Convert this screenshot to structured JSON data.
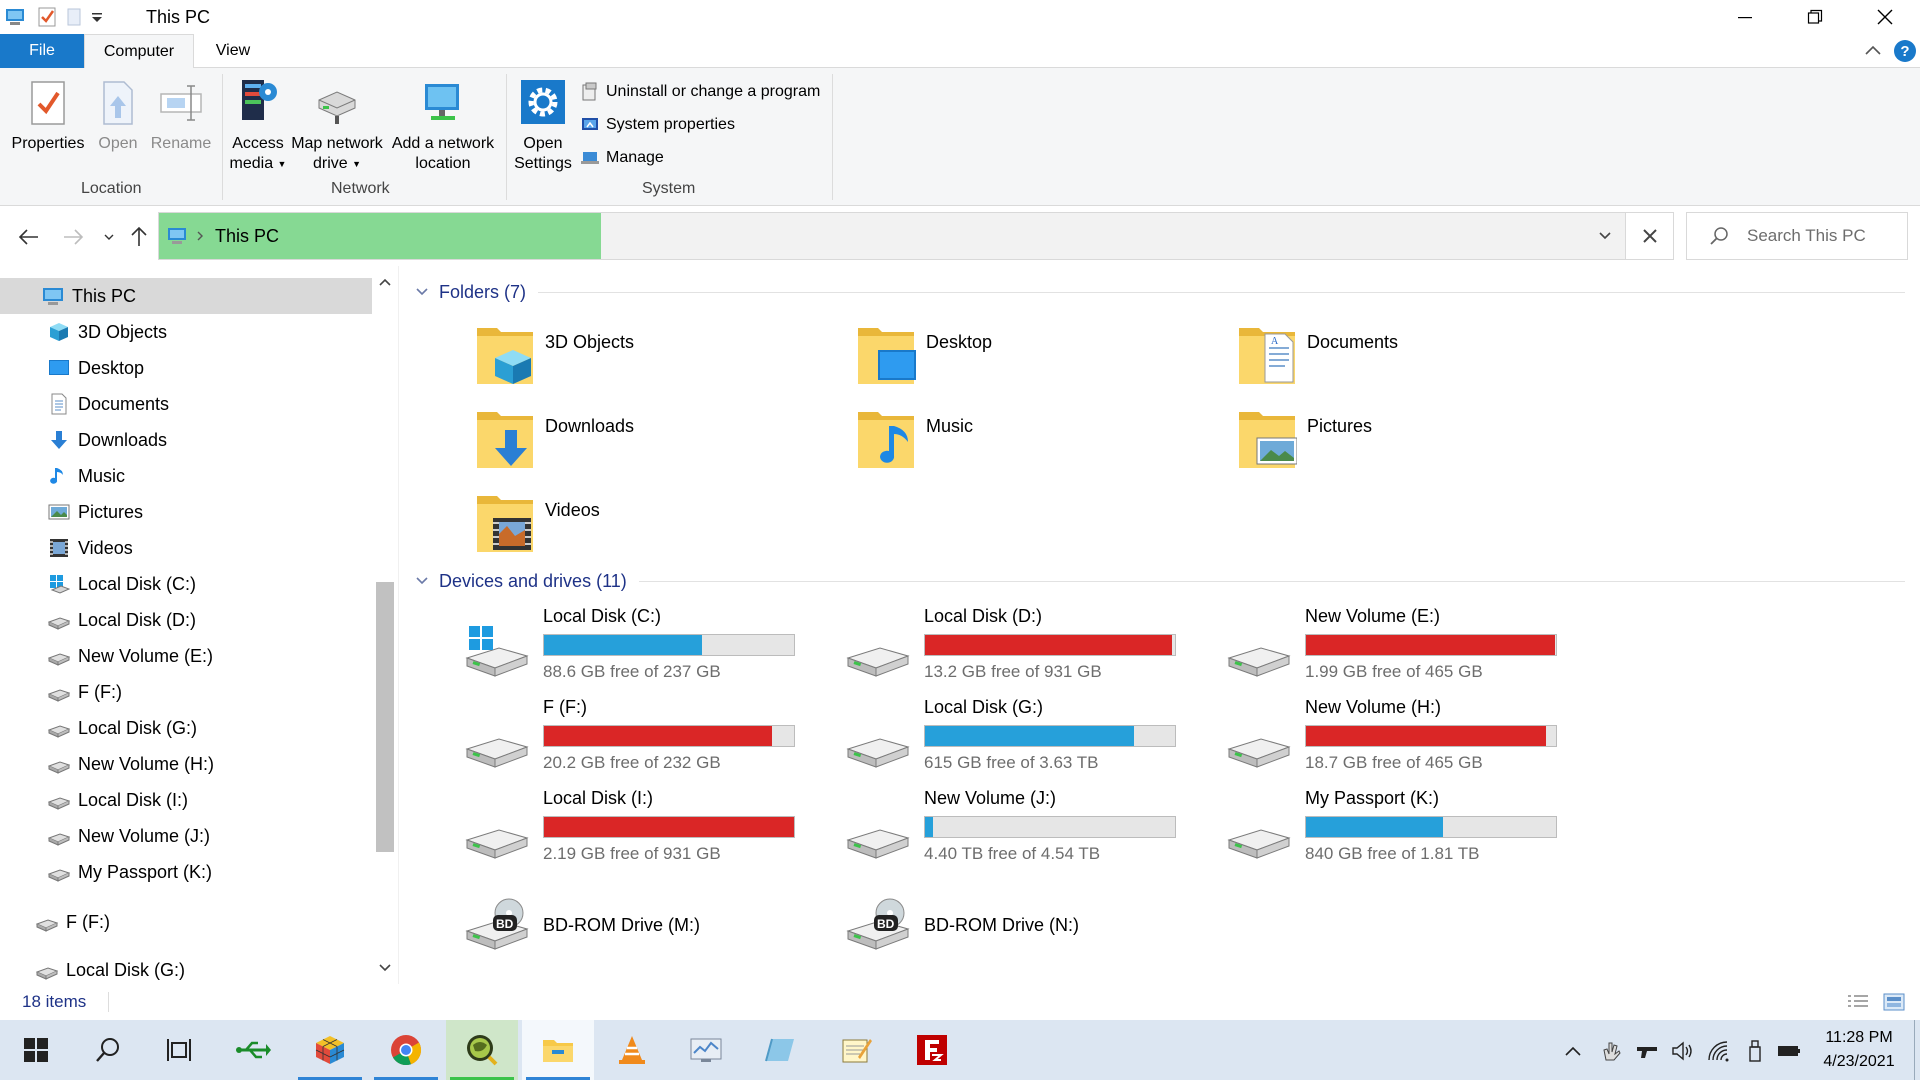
{
  "window": {
    "title": "This PC"
  },
  "tabs": {
    "file": "File",
    "computer": "Computer",
    "view": "View",
    "help": "?"
  },
  "ribbon": {
    "location": {
      "label": "Location",
      "properties": "Properties",
      "open": "Open",
      "rename": "Rename"
    },
    "network": {
      "label": "Network",
      "access_media_1": "Access",
      "access_media_2": "media",
      "map_drive_1": "Map network",
      "map_drive_2": "drive",
      "add_location_1": "Add a network",
      "add_location_2": "location"
    },
    "system": {
      "label": "System",
      "open_settings_1": "Open",
      "open_settings_2": "Settings",
      "uninstall": "Uninstall or change a program",
      "system_properties": "System properties",
      "manage": "Manage"
    }
  },
  "address": {
    "path": "This PC",
    "search_placeholder": "Search This PC"
  },
  "nav_pane": [
    {
      "label": "This PC",
      "icon": "computer-icon",
      "indent": 1,
      "selected": true
    },
    {
      "label": "3D Objects",
      "icon": "cube-icon",
      "indent": 2
    },
    {
      "label": "Desktop",
      "icon": "desktop-icon",
      "indent": 2
    },
    {
      "label": "Documents",
      "icon": "document-icon",
      "indent": 2
    },
    {
      "label": "Downloads",
      "icon": "download-icon",
      "indent": 2
    },
    {
      "label": "Music",
      "icon": "music-icon",
      "indent": 2
    },
    {
      "label": "Pictures",
      "icon": "pictures-icon",
      "indent": 2
    },
    {
      "label": "Videos",
      "icon": "video-icon",
      "indent": 2
    },
    {
      "label": "Local Disk (C:)",
      "icon": "system-drive-icon",
      "indent": 2
    },
    {
      "label": "Local Disk (D:)",
      "icon": "drive-icon",
      "indent": 2
    },
    {
      "label": "New Volume (E:)",
      "icon": "drive-icon",
      "indent": 2
    },
    {
      "label": "F (F:)",
      "icon": "drive-icon",
      "indent": 2
    },
    {
      "label": "Local Disk (G:)",
      "icon": "drive-icon",
      "indent": 2
    },
    {
      "label": "New Volume (H:)",
      "icon": "drive-icon",
      "indent": 2
    },
    {
      "label": "Local Disk (I:)",
      "icon": "drive-icon",
      "indent": 2
    },
    {
      "label": "New Volume (J:)",
      "icon": "drive-icon",
      "indent": 2
    },
    {
      "label": "My Passport (K:)",
      "icon": "drive-icon",
      "indent": 2
    },
    {
      "label": "F (F:)",
      "icon": "drive-icon",
      "indent": 1
    },
    {
      "label": "Local Disk (G:)",
      "icon": "drive-icon",
      "indent": 1
    }
  ],
  "folders": {
    "header": "Folders (7)",
    "items": [
      {
        "label": "3D Objects",
        "icon": "cube-folder-icon"
      },
      {
        "label": "Desktop",
        "icon": "desktop-folder-icon"
      },
      {
        "label": "Documents",
        "icon": "documents-folder-icon"
      },
      {
        "label": "Downloads",
        "icon": "downloads-folder-icon"
      },
      {
        "label": "Music",
        "icon": "music-folder-icon"
      },
      {
        "label": "Pictures",
        "icon": "pictures-folder-icon"
      },
      {
        "label": "Videos",
        "icon": "videos-folder-icon"
      }
    ]
  },
  "drives": {
    "header": "Devices and drives (11)",
    "items": [
      {
        "label": "Local Disk (C:)",
        "free": "88.6 GB free of 237 GB",
        "used_fraction": 0.63,
        "color": "#26a0da",
        "system": true
      },
      {
        "label": "Local Disk (D:)",
        "free": "13.2 GB free of 931 GB",
        "used_fraction": 0.986,
        "color": "#da2626"
      },
      {
        "label": "New Volume (E:)",
        "free": "1.99 GB free of 465 GB",
        "used_fraction": 0.996,
        "color": "#da2626"
      },
      {
        "label": "F (F:)",
        "free": "20.2 GB free of 232 GB",
        "used_fraction": 0.913,
        "color": "#da2626"
      },
      {
        "label": "Local Disk (G:)",
        "free": "615 GB free of 3.63 TB",
        "used_fraction": 0.835,
        "color": "#26a0da"
      },
      {
        "label": "New Volume (H:)",
        "free": "18.7 GB free of 465 GB",
        "used_fraction": 0.96,
        "color": "#da2626"
      },
      {
        "label": "Local Disk (I:)",
        "free": "2.19 GB free of 931 GB",
        "used_fraction": 0.998,
        "color": "#da2626"
      },
      {
        "label": "New Volume (J:)",
        "free": "4.40 TB free of 4.54 TB",
        "used_fraction": 0.031,
        "color": "#26a0da"
      },
      {
        "label": "My Passport (K:)",
        "free": "840 GB free of 1.81 TB",
        "used_fraction": 0.547,
        "color": "#26a0da"
      },
      {
        "label": "BD-ROM Drive (M:)",
        "free": "",
        "optical": true
      },
      {
        "label": "BD-ROM Drive (N:)",
        "free": "",
        "optical": true
      }
    ]
  },
  "status": {
    "count": "18 items"
  },
  "taskbar": {
    "time": "11:28 PM",
    "date": "4/23/2021"
  }
}
